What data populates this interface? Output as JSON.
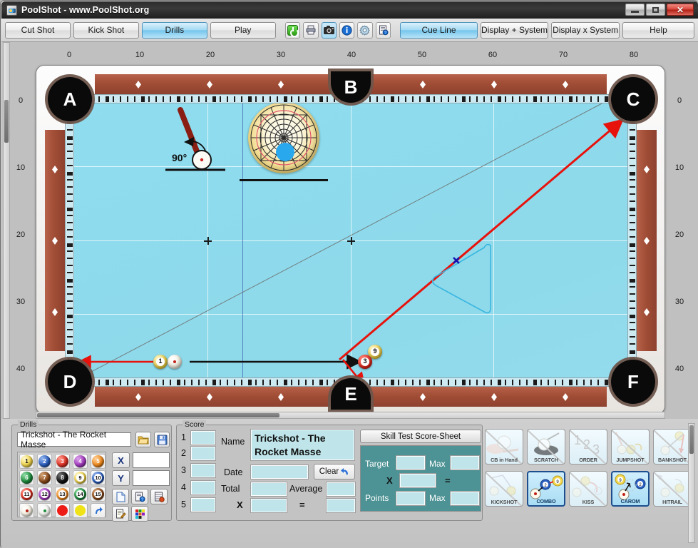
{
  "window": {
    "title": "PoolShot - www.PoolShot.org",
    "icon": "poolshot-app-icon",
    "minimize": "minimize",
    "maximize": "maximize",
    "close": "✕"
  },
  "toolbar": {
    "buttons": [
      {
        "label": "Cut Shot",
        "active": false
      },
      {
        "label": "Kick Shot",
        "active": false
      },
      {
        "label": "Drills",
        "active": true
      },
      {
        "label": "Play",
        "active": false
      }
    ],
    "icons": [
      {
        "name": "power-icon",
        "glyph": "⏻",
        "selected": false
      },
      {
        "name": "print-icon",
        "glyph": "🖨",
        "selected": false
      },
      {
        "name": "camera-icon",
        "glyph": "📷",
        "selected": true
      },
      {
        "name": "info-icon",
        "glyph": "i",
        "selected": false
      },
      {
        "name": "settings-gear-icon",
        "glyph": "✲",
        "selected": false
      },
      {
        "name": "document-help-icon",
        "glyph": "▤",
        "selected": false
      }
    ],
    "right_buttons": [
      {
        "label": "Cue Line",
        "active": true
      },
      {
        "label": "Display + System",
        "active": false
      },
      {
        "label": "Display x System",
        "active": false
      },
      {
        "label": "Help",
        "active": false
      }
    ]
  },
  "table": {
    "x_axis_labels": [
      "0",
      "10",
      "20",
      "30",
      "40",
      "50",
      "60",
      "70",
      "80"
    ],
    "y_axis_labels": [
      "0",
      "10",
      "20",
      "30",
      "40"
    ],
    "pockets": [
      {
        "id": "A",
        "label": "A"
      },
      {
        "id": "B",
        "label": "B"
      },
      {
        "id": "C",
        "label": "C"
      },
      {
        "id": "D",
        "label": "D"
      },
      {
        "id": "E",
        "label": "E"
      },
      {
        "id": "F",
        "label": "F"
      }
    ],
    "balls": [
      {
        "name": "ball-1",
        "number": "1",
        "color": "#f0d74a",
        "striped": false
      },
      {
        "name": "cue-ball",
        "number": "",
        "color": "#f5f0e2",
        "striped": false
      },
      {
        "name": "ball-9",
        "number": "9",
        "color": "#f0d74a",
        "striped": true
      },
      {
        "name": "ball-3",
        "number": "3",
        "color": "#e53226",
        "striped": false
      }
    ],
    "annotations": {
      "masse_angle": "90°",
      "target_marker": "x"
    }
  },
  "drills": {
    "group_title": "Drills",
    "selected_drill": "Trickshot - The Rocket Masse",
    "open_icon": "folder-open-icon",
    "save_icon": "floppy-save-icon",
    "x_label": "X",
    "y_label": "Y",
    "x_value": "",
    "y_value": "",
    "ball_buttons": [
      {
        "n": "1",
        "color": "#f2d64c",
        "striped": false
      },
      {
        "n": "2",
        "color": "#2a5fc0",
        "striped": false
      },
      {
        "n": "3",
        "color": "#e03225",
        "striped": false
      },
      {
        "n": "4",
        "color": "#a43bc0",
        "striped": false
      },
      {
        "n": "5",
        "color": "#f08a1e",
        "striped": false
      },
      {
        "n": "6",
        "color": "#1f8d3e",
        "striped": false
      },
      {
        "n": "7",
        "color": "#8a4a1c",
        "striped": false
      },
      {
        "n": "8",
        "color": "#111111",
        "striped": false
      },
      {
        "n": "9",
        "color": "#f2d64c",
        "striped": true
      },
      {
        "n": "10",
        "color": "#2a5fc0",
        "striped": true
      },
      {
        "n": "11",
        "color": "#e03225",
        "striped": true
      },
      {
        "n": "12",
        "color": "#a43bc0",
        "striped": true
      },
      {
        "n": "13",
        "color": "#f08a1e",
        "striped": true
      },
      {
        "n": "14",
        "color": "#1f8d3e",
        "striped": true
      },
      {
        "n": "15",
        "color": "#8a4a1c",
        "striped": true
      }
    ],
    "extra_buttons": [
      {
        "name": "cue-ball-button",
        "color": "#f5f0e2"
      },
      {
        "name": "ghost-ball-button",
        "color": "#f0f0ee"
      },
      {
        "name": "red-object-ball-button",
        "color": "#ee1c16"
      },
      {
        "name": "yellow-object-ball-button",
        "color": "#efe317"
      },
      {
        "name": "reset-arrow-button",
        "color": "#2b6fd6"
      }
    ],
    "tool_buttons": [
      {
        "name": "new-page-icon"
      },
      {
        "name": "page-help-icon"
      },
      {
        "name": "table-settings-icon"
      },
      {
        "name": "edit-notes-icon"
      },
      {
        "name": "color-palette-icon"
      }
    ]
  },
  "score": {
    "group_title": "Score",
    "row_numbers": [
      "1",
      "2",
      "3",
      "4",
      "5"
    ],
    "row_values": [
      "",
      "",
      "",
      "",
      ""
    ],
    "name_label": "Name",
    "name_value": "Trickshot - The Rocket Masse",
    "date_label": "Date",
    "date_value": "",
    "clear_label": "Clear",
    "clear_icon": "undo-arrow-icon",
    "total_label": "Total",
    "total_value": "",
    "average_label": "Average",
    "average_value": "",
    "multiply_label": "X",
    "multiply_value": "",
    "equals_label": "=",
    "equals_value": ""
  },
  "skill_test": {
    "title": "Skill Test Score-Sheet",
    "target_label": "Target",
    "target_value": "",
    "target_max_label": "Max",
    "target_max_value": "",
    "multiply_label": "X",
    "multiply_value": "",
    "equals_label": "=",
    "equals_value": "",
    "points_label": "Points",
    "points_value": "",
    "points_max_label": "Max",
    "points_max_value": ""
  },
  "shot_options": {
    "row1": [
      {
        "label": "CB in Hand",
        "name": "cb-in-hand-button",
        "on": false
      },
      {
        "label": "SCRATCH",
        "name": "scratch-button",
        "on": false
      },
      {
        "label": "ORDER",
        "name": "order-button",
        "on": false
      },
      {
        "label": "JUMPSHOT",
        "name": "jumpshot-button",
        "on": false
      },
      {
        "label": "BANKSHOT",
        "name": "bankshot-button",
        "on": false
      }
    ],
    "row2": [
      {
        "label": "KICKSHOT",
        "name": "kickshot-button",
        "on": false
      },
      {
        "label": "COMBO",
        "name": "combo-button",
        "on": true
      },
      {
        "label": "KISS",
        "name": "kiss-button",
        "on": false
      },
      {
        "label": "CAROM",
        "name": "carom-button",
        "on": true
      },
      {
        "label": "HITRAIL",
        "name": "hitrail-button",
        "on": false
      }
    ]
  },
  "colors": {
    "felt": "#8ddbed",
    "rail_wood": "#a8533c",
    "accent_blue": "#76c6ec",
    "teal_panel": "#4d9294",
    "field_cyan": "#bfe5ea",
    "shot_red": "#e8120c"
  }
}
